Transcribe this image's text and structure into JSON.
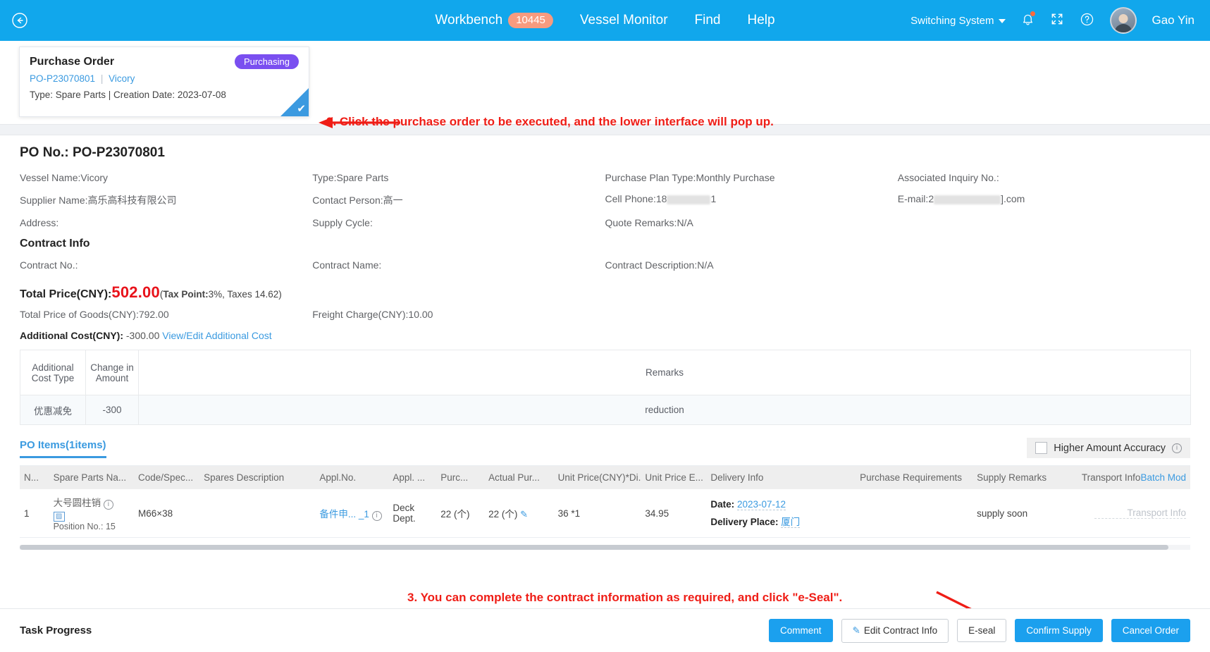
{
  "topbar": {
    "back_icon": "back-circle-icon",
    "nav": [
      {
        "label": "Workbench",
        "badge": "10445"
      },
      {
        "label": "Vessel Monitor"
      },
      {
        "label": "Find"
      },
      {
        "label": "Help"
      }
    ],
    "switching_system": "Switching System",
    "bell_icon": "bell-icon",
    "fullscreen_icon": "fullscreen-icon",
    "help_icon": "question-circle-icon",
    "user_name": "Gao Yin",
    "bg_color": "#11a7ec"
  },
  "po_card": {
    "title": "Purchase Order",
    "status": "Purchasing",
    "status_color": "#7a4ff0",
    "po_number": "PO-P23070801",
    "separator": "|",
    "vessel": "Vicory",
    "meta": "Type:  Spare Parts |  Creation Date:  2023-07-08",
    "selected_check": "✔"
  },
  "annotations": {
    "step2": "2. Click the purchase order to be executed, and the lower interface will pop up.",
    "step3": "3. You can complete the contract information as required, and click \"e-Seal\".",
    "color": "#ef1d16"
  },
  "detail": {
    "po_no_label": "PO No.:",
    "po_no_value": "PO-P23070801",
    "fields_row1": [
      {
        "label": "Vessel Name:",
        "value": "Vicory"
      },
      {
        "label": "Type:",
        "value": "Spare Parts"
      },
      {
        "label": "Purchase Plan Type:",
        "value": "Monthly Purchase"
      },
      {
        "label": "Associated Inquiry No.:",
        "value": ""
      }
    ],
    "fields_row2": [
      {
        "label": "Supplier Name:",
        "value": "高乐高科技有限公司"
      },
      {
        "label": "Contact Person:",
        "value": "高一"
      },
      {
        "label": "Cell Phone:",
        "value": "18",
        "redacted": true,
        "value_tail": "1"
      },
      {
        "label": "E-mail:",
        "value": "2",
        "redacted": true,
        "value_tail": "].com"
      }
    ],
    "fields_row3": [
      {
        "label": "Address:",
        "value": ""
      },
      {
        "label": "Supply Cycle:",
        "value": ""
      },
      {
        "label": "Quote Remarks:",
        "value": "N/A"
      },
      {
        "label": "",
        "value": ""
      }
    ],
    "contract_title": "Contract Info",
    "contract_fields": [
      {
        "label": "Contract No.:",
        "value": ""
      },
      {
        "label": "Contract Name:",
        "value": ""
      },
      {
        "label": "Contract Description:",
        "value": "N/A"
      }
    ],
    "total_price_label": "Total Price(CNY):",
    "total_price_value": "502.00",
    "tax_open": "(",
    "tax_point_label": "Tax Point:",
    "tax_point_value": "3%, Taxes 14.62)",
    "total_goods": "Total Price of Goods(CNY):792.00",
    "freight": "Freight Charge(CNY):10.00",
    "additional_cost_label": "Additional Cost(CNY):",
    "additional_cost_value": "-300.00",
    "additional_cost_link": "View/Edit Additional Cost"
  },
  "additional_cost_table": {
    "headers": [
      "Additional Cost Type",
      "Change in Amount",
      "Remarks"
    ],
    "rows": [
      {
        "type": "优惠减免",
        "amount": "-300",
        "remarks": "reduction"
      }
    ]
  },
  "items_section": {
    "tab_label": "PO Items(1items)",
    "higher_accuracy_label": "Higher Amount Accuracy",
    "higher_accuracy_checked": false,
    "batch_mod_link": "Batch Mod",
    "headers": [
      "N...",
      "Spare Parts Na...",
      "Code/Spec...",
      "Spares Description",
      "Appl.No.",
      "Appl. ...",
      "Purc...",
      "Actual Pur...",
      "Unit Price(CNY)*Di...",
      "Unit Price E...",
      "Delivery Info",
      "Purchase Requirements",
      "Supply Remarks",
      "Transport Info"
    ],
    "rows": [
      {
        "no": "1",
        "part_name": "大号圆柱销",
        "position_label": "Position No.:",
        "position_value": "15",
        "code_spec": "M66×38",
        "spares_description": "",
        "appl_no": "备件申... _1",
        "appl_dept": "Deck Dept.",
        "purc_qty": "22 (个)",
        "actual_qty": "22 (个)",
        "unit_price_discount": "36 *1",
        "unit_price_excl": "34.95",
        "delivery_date_label": "Date:",
        "delivery_date_value": "2023-07-12",
        "delivery_place_label": "Delivery Place:",
        "delivery_place_value": "厦门",
        "purchase_requirements": "",
        "supply_remarks": "supply soon",
        "transport_info_placeholder": "Transport Info"
      }
    ]
  },
  "footer": {
    "task_progress": "Task Progress",
    "buttons": [
      {
        "label": "Comment",
        "style": "primary"
      },
      {
        "label": "Edit Contract Info",
        "style": "ghost",
        "icon": "pencil-icon"
      },
      {
        "label": "E-seal",
        "style": "ghost"
      },
      {
        "label": "Confirm Supply",
        "style": "primary"
      },
      {
        "label": "Cancel Order",
        "style": "primary"
      }
    ]
  }
}
